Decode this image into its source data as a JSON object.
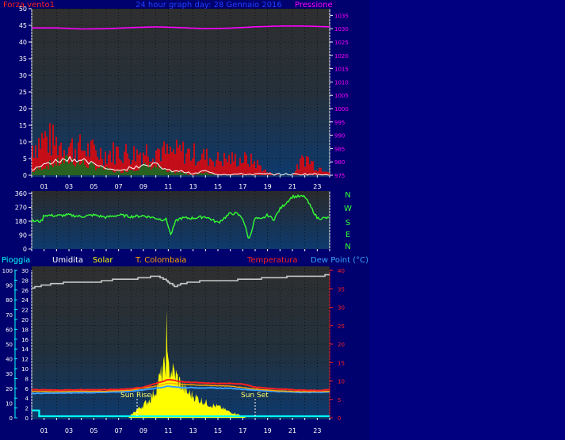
{
  "colors": {
    "background": "#000080",
    "plot_top": "#2f2f2f",
    "plot_bottom": "#0d3a6e",
    "wind": "#ff2020",
    "gust_fill": "#ff0000",
    "avg_wind": "#ffffff",
    "avg_fill": "#0a7a1a",
    "pressure": "#ff00ff",
    "direction": "#33ff33",
    "humidity": "#c8c8c8",
    "temperature": "#ff2020",
    "dewpoint": "#3aa0ff",
    "solar": "#ffff00",
    "rain": "#00ffff",
    "colombia": "#ffa500",
    "title": "#2040ff",
    "axis_text": "#ffffff"
  },
  "header": {
    "left_label": "Forza vento1",
    "title": "24 hour graph day: 28 Gennaio 2016",
    "right_label": "Pressione"
  },
  "x_ticks": [
    "01",
    "03",
    "05",
    "07",
    "09",
    "11",
    "13",
    "15",
    "17",
    "19",
    "21",
    "23"
  ],
  "dir_labels": [
    "N",
    "W",
    "S",
    "E",
    "N"
  ],
  "legend": {
    "rain": "Pioggia",
    "humidity": "Umidita",
    "solar": "Solar",
    "colombia": "T. Colombaia",
    "temperature": "Temperatura",
    "dewpoint": "Dew Point (°C)"
  },
  "annotations": {
    "sunrise": "Sun Rise",
    "sunset": "Sun Set"
  },
  "chart_data": [
    {
      "type": "line",
      "title": "24 hour graph day: 28 Gennaio 2016",
      "x_range_hours": [
        0,
        24
      ],
      "left_axis": {
        "label": "Forza vento1",
        "ylim": [
          0,
          50
        ],
        "ticks": [
          0,
          5,
          10,
          15,
          20,
          25,
          30,
          35,
          40,
          45,
          50
        ]
      },
      "right_axis": {
        "label": "Pressione",
        "ylim": [
          975,
          1037.5
        ],
        "ticks": [
          975,
          980,
          985,
          990,
          995,
          1000,
          1005,
          1010,
          1015,
          1020,
          1025,
          1030,
          1035
        ]
      },
      "series": [
        {
          "name": "Pressione",
          "x": [
            0,
            2,
            4,
            6,
            8,
            10,
            12,
            14,
            16,
            18,
            20,
            22,
            24
          ],
          "values": [
            1030.3,
            1030.3,
            1029.9,
            1030.0,
            1030.4,
            1030.7,
            1030.4,
            1030.0,
            1030.2,
            1030.7,
            1031.0,
            1031.0,
            1030.7
          ]
        },
        {
          "name": "wind gust",
          "x": [
            0,
            1,
            2,
            3,
            4,
            5,
            6,
            7,
            8,
            9,
            10,
            11,
            12,
            13,
            14,
            15,
            16,
            17,
            18,
            19,
            20,
            21,
            22,
            23,
            24
          ],
          "values": [
            11,
            14,
            12,
            11,
            10,
            9,
            8,
            9,
            8,
            9,
            10,
            8,
            9,
            8,
            7,
            6,
            6,
            6,
            5,
            1,
            0,
            0,
            7,
            3,
            2
          ]
        },
        {
          "name": "wind avg",
          "x": [
            0,
            1,
            2,
            3,
            4,
            5,
            6,
            7,
            8,
            9,
            10,
            11,
            12,
            13,
            14,
            15,
            16,
            17,
            18,
            19,
            20,
            21,
            22,
            23,
            24
          ],
          "values": [
            1,
            3,
            4,
            5,
            4,
            3,
            2,
            1,
            2,
            3,
            3,
            1,
            1,
            0,
            1,
            0,
            0,
            0,
            0,
            0,
            0,
            0,
            0,
            0,
            0
          ]
        }
      ]
    },
    {
      "type": "line",
      "x_range_hours": [
        0,
        24
      ],
      "ylim": [
        0,
        360
      ],
      "y_ticks": [
        0,
        90,
        180,
        270,
        360
      ],
      "series": [
        {
          "name": "direction",
          "x": [
            0,
            0.8,
            1.0,
            2,
            3,
            4,
            5,
            6,
            7,
            8,
            9,
            10,
            10.5,
            10.8,
            11,
            11.2,
            11.6,
            12,
            13,
            14,
            15,
            16,
            16.5,
            17,
            17.5,
            18,
            18.5,
            19,
            19.5,
            20,
            21,
            21.5,
            22,
            23,
            23.3,
            24
          ],
          "values": [
            180,
            180,
            220,
            215,
            220,
            210,
            220,
            205,
            220,
            210,
            215,
            200,
            190,
            195,
            150,
            90,
            180,
            200,
            200,
            210,
            170,
            230,
            230,
            200,
            60,
            200,
            190,
            220,
            190,
            260,
            340,
            340,
            340,
            200,
            200,
            200
          ]
        }
      ]
    },
    {
      "type": "line",
      "x_range_hours": [
        0,
        24
      ],
      "left_axis": {
        "label": "Pioggia",
        "ylim": [
          0,
          100
        ],
        "ticks": [
          0,
          10,
          20,
          30,
          40,
          50,
          60,
          70,
          80,
          90,
          100
        ]
      },
      "inner_axis": {
        "label": "Umidita",
        "ylim": [
          0,
          30
        ],
        "ticks": [
          0,
          2,
          4,
          6,
          8,
          10,
          12,
          14,
          16,
          18,
          20,
          22,
          24,
          26,
          28,
          30
        ]
      },
      "right_axis": {
        "label": "Temperatura",
        "ylim": [
          0,
          40
        ],
        "ticks": [
          0,
          5,
          10,
          15,
          20,
          25,
          30,
          35,
          40
        ]
      },
      "series": [
        {
          "name": "Umidita",
          "x": [
            0,
            1,
            2,
            3,
            4,
            5,
            6,
            7,
            8,
            9,
            10,
            10.5,
            11,
            11.5,
            12,
            13,
            14,
            15,
            16,
            17,
            18,
            19,
            20,
            21,
            22,
            23,
            24
          ],
          "values": [
            88,
            90,
            91,
            92,
            92,
            92,
            93,
            94,
            94,
            95,
            96,
            95,
            92,
            89,
            91,
            92,
            93,
            93,
            93,
            94,
            94,
            95,
            95,
            96,
            96,
            96,
            97
          ]
        },
        {
          "name": "Temperatura",
          "x": [
            0,
            2,
            4,
            6,
            7,
            8,
            9,
            10,
            11,
            12,
            13,
            14,
            15,
            16,
            17,
            18,
            19,
            20,
            21,
            22,
            23,
            24
          ],
          "values": [
            7.6,
            7.5,
            7.6,
            7.6,
            7.7,
            7.9,
            8.3,
            9.3,
            10.4,
            9.8,
            9.6,
            9.4,
            9.3,
            9.3,
            9.2,
            8.3,
            8.0,
            7.8,
            7.6,
            7.5,
            7.4,
            7.6
          ]
        },
        {
          "name": "T. Colombaia",
          "x": [
            0,
            2,
            4,
            6,
            8,
            10,
            11,
            12,
            14,
            16,
            18,
            20,
            22,
            24
          ],
          "values": [
            7.2,
            7.1,
            7.2,
            7.2,
            7.5,
            8.6,
            9.4,
            9.1,
            8.8,
            8.6,
            7.8,
            7.3,
            7.1,
            7.2
          ]
        },
        {
          "name": "Dew Point (°C)",
          "x": [
            0,
            2,
            4,
            6,
            8,
            10,
            11,
            12,
            14,
            16,
            18,
            20,
            22,
            24
          ],
          "values": [
            6.6,
            6.7,
            6.8,
            6.9,
            7.2,
            8.0,
            8.6,
            8.2,
            8.1,
            8.0,
            7.5,
            7.1,
            6.9,
            7.0
          ]
        },
        {
          "name": "Solar",
          "x": [
            7.8,
            8,
            8.5,
            9,
            9.5,
            10,
            10.3,
            10.5,
            10.8,
            10.85,
            10.9,
            11,
            11.5,
            12,
            12.5,
            13,
            13.5,
            14,
            14.5,
            15,
            15.5,
            16,
            16.5,
            17,
            17.3
          ],
          "values": [
            0,
            2,
            6,
            9,
            13,
            20,
            28,
            32,
            38,
            73,
            42,
            35,
            32,
            24,
            18,
            16,
            13,
            11,
            9,
            8,
            6,
            4,
            3,
            1,
            0
          ]
        },
        {
          "name": "Pioggia",
          "x": [
            0,
            0.6,
            0.65,
            24
          ],
          "values": [
            1.5,
            1.5,
            0.3,
            0.3
          ]
        }
      ]
    }
  ]
}
